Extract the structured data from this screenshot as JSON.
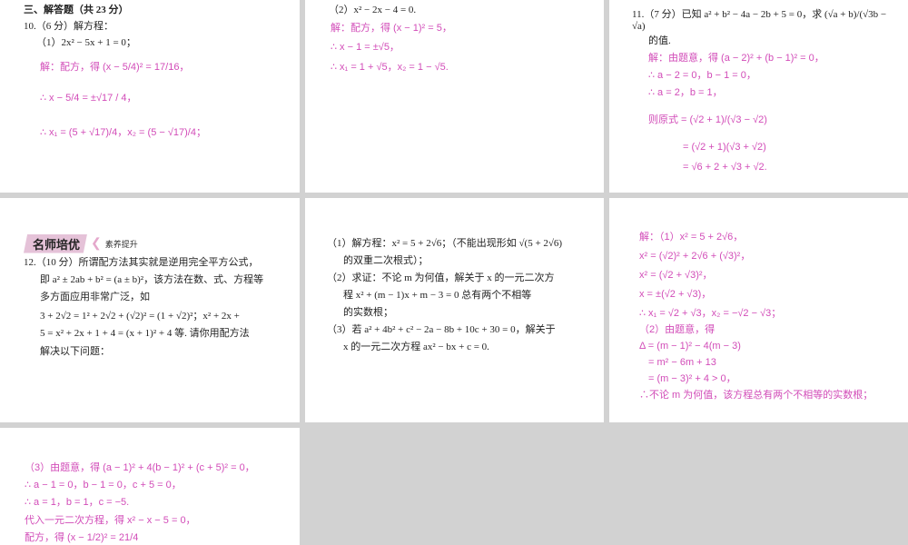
{
  "colors": {
    "answer": "#d24cb8",
    "background": "#d2d2d2"
  },
  "p1": {
    "section": "三、解答题（共 23 分）",
    "q10": "10.（6 分）解方程：",
    "q10_1": "（1）2x² − 5x + 1 = 0；",
    "a1": "解：配方，得 (x − 5/4)² = 17/16，",
    "a2": "∴ x − 5/4 = ±√17 / 4，",
    "a3": "∴ x₁ = (5 + √17)/4，x₂ = (5 − √17)/4；"
  },
  "p2": {
    "q10_2": "（2）x² − 2x − 4 = 0.",
    "a1": "解：配方，得 (x − 1)² = 5，",
    "a2": "∴ x − 1 = ±√5，",
    "a3": "∴ x₁ = 1 + √5，x₂ = 1 − √5."
  },
  "p3": {
    "q11": "11.（7 分）已知 a² + b² − 4a − 2b + 5 = 0，求 (√a + b)/(√3b − √a)",
    "q11b": "的值.",
    "a1": "解：由题意，得 (a − 2)² + (b − 1)² = 0，",
    "a2": "∴ a − 2 = 0，b − 1 = 0，",
    "a3": "∴ a = 2，b = 1，",
    "a4": "则原式 = (√2 + 1)/(√3 − √2)",
    "a5": "= (√2 + 1)(√3 + √2)",
    "a6": "= √6 + 2 + √3 + √2."
  },
  "p4": {
    "badge": "名师培优",
    "badge_sub": "素养提升",
    "l1": "12.（10 分）所谓配方法其实就是逆用完全平方公式，",
    "l2": "即 a² ± 2ab + b² = (a ± b)²，该方法在数、式、方程等",
    "l3": "多方面应用非常广泛，如",
    "l4": "3 + 2√2 = 1² + 2√2 + (√2)² = (1 + √2)²；x² + 2x +",
    "l5": "5 = x² + 2x + 1 + 4 = (x + 1)² + 4 等. 请你用配方法",
    "l6": "解决以下问题："
  },
  "p5": {
    "l1": "（1）解方程：x² = 5 + 2√6；（不能出现形如 √(5 + 2√6)",
    "l2": "的双重二次根式）；",
    "l3": "（2）求证：不论 m 为何值，解关于 x 的一元二次方",
    "l4": "程 x² + (m − 1)x + m − 3 = 0 总有两个不相等",
    "l5": "的实数根；",
    "l6": "（3）若 a² + 4b² + c² − 2a − 8b + 10c + 30 = 0，解关于",
    "l7": "x 的一元二次方程 ax² − bx + c = 0."
  },
  "p6": {
    "l1": "解：（1）x² = 5 + 2√6，",
    "l2": "x² = (√2)² + 2√6 + (√3)²，",
    "l3": "x² = (√2 + √3)²，",
    "l4": "x = ±(√2 + √3)，",
    "l5": "∴ x₁ = √2 + √3，x₂ = −√2 − √3；",
    "l6": "（2）由题意，得",
    "l7": "Δ = (m − 1)² − 4(m − 3)",
    "l8": "= m² − 6m + 13",
    "l9": "= (m − 3)² + 4 > 0，",
    "l10": "∴不论 m 为何值，该方程总有两个不相等的实数根；"
  },
  "p7": {
    "l1": "（3）由题意，得 (a − 1)² + 4(b − 1)² + (c + 5)² = 0，",
    "l2": "∴ a − 1 = 0，b − 1 = 0，c + 5 = 0，",
    "l3": "∴ a = 1，b = 1，c = −5.",
    "l4": "代入一元二次方程，得 x² − x − 5 = 0，",
    "l5": "配方，得 (x − 1/2)² = 21/4"
  }
}
